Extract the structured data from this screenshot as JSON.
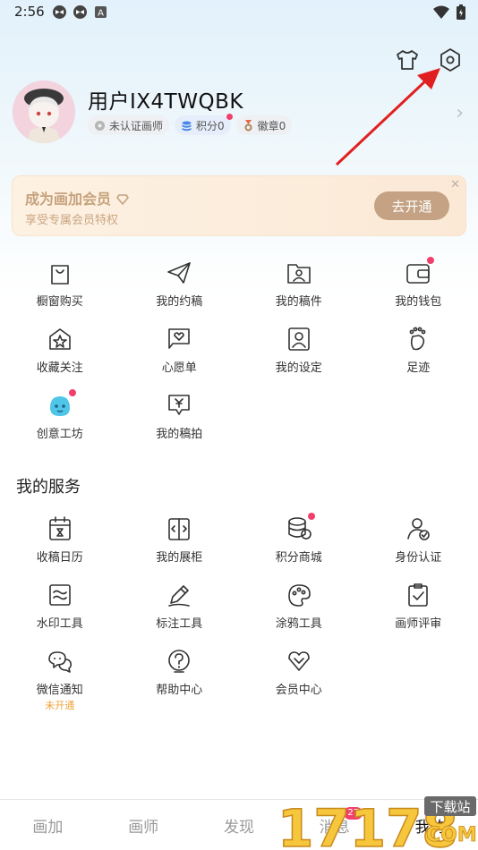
{
  "status": {
    "time": "2:56"
  },
  "user": {
    "name": "用户IX4TWQBK",
    "badges": [
      {
        "label": "未认证画师",
        "icon": "gear-badge-icon"
      },
      {
        "label": "积分0",
        "icon": "coin-stack-icon"
      },
      {
        "label": "徽章0",
        "icon": "medal-icon"
      }
    ]
  },
  "vip": {
    "title": "成为画加会员",
    "subtitle": "享受专属会员特权",
    "button": "去开通"
  },
  "menu": [
    {
      "label": "橱窗购买",
      "icon": "shopping-bag-icon"
    },
    {
      "label": "我的约稿",
      "icon": "paper-plane-icon"
    },
    {
      "label": "我的稿件",
      "icon": "folder-user-icon"
    },
    {
      "label": "我的钱包",
      "icon": "wallet-icon",
      "dot": true
    },
    {
      "label": "收藏关注",
      "icon": "star-box-icon"
    },
    {
      "label": "心愿单",
      "icon": "heart-box-icon"
    },
    {
      "label": "我的设定",
      "icon": "person-card-icon"
    },
    {
      "label": "足迹",
      "icon": "footprint-icon"
    },
    {
      "label": "创意工坊",
      "icon": "blob-mascot-icon",
      "dot": true
    },
    {
      "label": "我的稿拍",
      "icon": "yen-chat-icon"
    }
  ],
  "services_title": "我的服务",
  "services": [
    {
      "label": "收稿日历",
      "icon": "calendar-icon"
    },
    {
      "label": "我的展柜",
      "icon": "showcase-icon"
    },
    {
      "label": "积分商城",
      "icon": "coin-stack-icon",
      "dot": true
    },
    {
      "label": "身份认证",
      "icon": "verified-user-icon"
    },
    {
      "label": "水印工具",
      "icon": "watermark-icon"
    },
    {
      "label": "标注工具",
      "icon": "pen-icon"
    },
    {
      "label": "涂鸦工具",
      "icon": "palette-icon"
    },
    {
      "label": "画师评审",
      "icon": "clipboard-check-icon"
    },
    {
      "label": "微信通知",
      "icon": "wechat-icon",
      "sub": "未开通"
    },
    {
      "label": "帮助中心",
      "icon": "help-icon"
    },
    {
      "label": "会员中心",
      "icon": "vip-heart-icon"
    }
  ],
  "tabs": [
    {
      "label": "画加"
    },
    {
      "label": "画师"
    },
    {
      "label": "发现"
    },
    {
      "label": "消息",
      "badge": "27"
    },
    {
      "label": "我的"
    }
  ],
  "watermark": {
    "text": "17178",
    "tag": "下载站",
    "domain": "COM"
  },
  "colors": {
    "accent": "#f0406b",
    "vip": "#c4a283",
    "arrow": "#e02020"
  }
}
